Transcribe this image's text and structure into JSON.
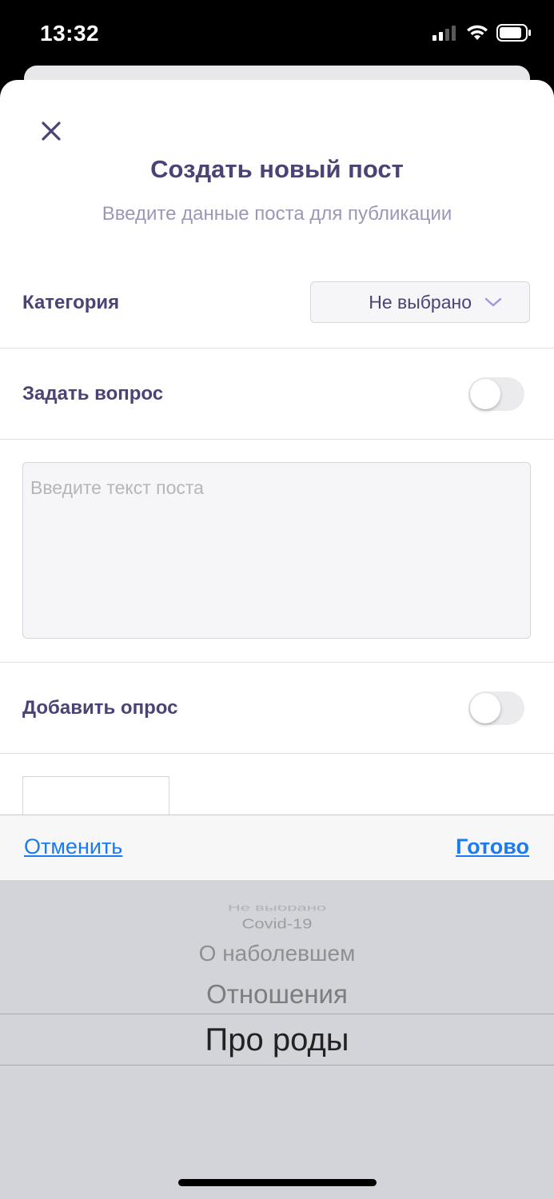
{
  "status_bar": {
    "time": "13:32"
  },
  "header": {
    "title": "Создать новый пост",
    "subtitle": "Введите данные поста для публикации"
  },
  "category": {
    "label": "Категория",
    "value": "Не выбрано"
  },
  "ask_question": {
    "label": "Задать вопрос",
    "enabled": false
  },
  "post_text": {
    "placeholder": "Введите текст поста",
    "value": ""
  },
  "poll": {
    "label": "Добавить опрос",
    "enabled": false
  },
  "toolbar": {
    "cancel_label": "Отменить",
    "done_label": "Готово"
  },
  "picker": {
    "options": [
      "Не выбрано",
      "Covid-19",
      "О наболевшем",
      "Отношения",
      "Про роды"
    ],
    "selected": "Про роды"
  },
  "colors": {
    "accent": "#4a4476",
    "link": "#1a7cf0",
    "picker_bg": "#d2d4d9"
  }
}
